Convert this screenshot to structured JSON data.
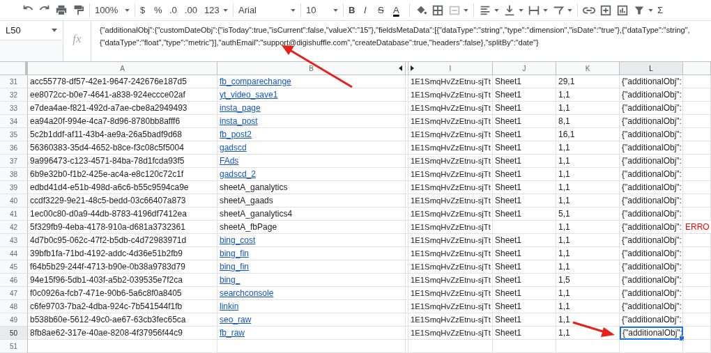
{
  "toolbar": {
    "zoom": "100%",
    "currency": "$",
    "percent": "%",
    "decrease_decimals": ".0",
    "increase_decimals": ".00",
    "number_format": "123",
    "font": "Arial",
    "font_size": "10",
    "bold": "B",
    "italic": "I",
    "strikethrough": "S",
    "text_color": "A",
    "functions": "Σ"
  },
  "name_box": "L50",
  "formula_icon": "fx",
  "formula": [
    "{\"additionalObj\":{\"customDateObj\":{\"isToday\":true,\"isCurrent\":false,\"valueX\":\"15\"},\"fieldsMetaData\":[{\"dataType\":\"string\",\"type\":\"dimension\",\"isDate\":\"true\"},{\"dataType\":\"string\",",
    "{\"dataType\":\"float\",\"type\":\"metric\"}],\"authEmail\":\"support@digishuffle.com\",\"createDatabase\":true,\"headers\":false},\"splitBy\":\"date\"}"
  ],
  "columns": [
    {
      "label": "A",
      "selected": false
    },
    {
      "label": "B",
      "selected": false
    },
    {
      "label": "I",
      "selected": false
    },
    {
      "label": "J",
      "selected": false
    },
    {
      "label": "K",
      "selected": false
    },
    {
      "label": "L",
      "selected": true
    }
  ],
  "rows": [
    {
      "number": "31",
      "a": "acc55778-df57-42e1-9647-242676e187d5",
      "b": "fb_comparechange",
      "link": true,
      "i": "1E1SmqHvZzEtnu-sjTt",
      "j": "Sheet1",
      "k": "29,1",
      "l": "{\"additionalObj\":",
      "selected": false
    },
    {
      "number": "32",
      "a": "ee8072cc-b0e7-4641-a838-924eccce02af",
      "b": "yt_video_save1",
      "link": true,
      "i": "1E1SmqHvZzEtnu-sjTt",
      "j": "Sheet1",
      "k": "1,1",
      "l": "{\"additionalObj\":",
      "selected": false
    },
    {
      "number": "33",
      "a": "e7dea4ae-f821-492d-a7ae-cbe8a2949493",
      "b": "insta_page",
      "link": true,
      "i": "1E1SmqHvZzEtnu-sjTt",
      "j": "Sheet1",
      "k": "1,1",
      "l": "{\"additionalObj\":",
      "selected": false
    },
    {
      "number": "34",
      "a": "ea94a20f-994e-4ca7-8d96-8780bb8afff6",
      "b": "insta_post",
      "link": true,
      "i": "1E1SmqHvZzEtnu-sjTt",
      "j": "Sheet1",
      "k": "8,1",
      "l": "{\"additionalObj\":",
      "selected": false
    },
    {
      "number": "35",
      "a": "5c2b1ddf-af11-43b4-ae9a-26a5badf9d68",
      "b": "fb_post2",
      "link": true,
      "i": "1E1SmqHvZzEtnu-sjTt",
      "j": "Sheet1",
      "k": "16,1",
      "l": "{\"additionalObj\":",
      "selected": false
    },
    {
      "number": "36",
      "a": "56360383-35d4-4652-b8ce-f3c08c5f5004",
      "b": "gadscd",
      "link": true,
      "i": "1E1SmqHvZzEtnu-sjTt",
      "j": "Sheet1",
      "k": "1,1",
      "l": "{\"additionalObj\":",
      "selected": false
    },
    {
      "number": "37",
      "a": "9a996473-c123-4571-84ba-78d1fcda93f5",
      "b": "FAds",
      "link": true,
      "i": "1E1SmqHvZzEtnu-sjTt",
      "j": "Sheet1",
      "k": "1,1",
      "l": "{\"additionalObj\":",
      "selected": false
    },
    {
      "number": "38",
      "a": "6b9e32b0-f1b2-425e-ac4a-e8c120c72c1f",
      "b": "gadscd_2",
      "link": true,
      "i": "1E1SmqHvZzEtnu-sjTt",
      "j": "Sheet1",
      "k": "1,1",
      "l": "{\"additionalObj\":",
      "selected": false
    },
    {
      "number": "39",
      "a": "edbd41d4-e51b-498d-a6c6-b55c9594ca9e",
      "b": "sheetA_ganalytics",
      "link": false,
      "i": "1E1SmqHvZzEtnu-sjTt",
      "j": "Sheet1",
      "k": "1,1",
      "l": "{\"additionalObj\":",
      "selected": false
    },
    {
      "number": "40",
      "a": "ccdf3229-9e21-48c5-bedd-03c66407a873",
      "b": "sheetA_gaads",
      "link": false,
      "i": "1E1SmqHvZzEtnu-sjTt",
      "j": "Sheet1",
      "k": "1,1",
      "l": "{\"additionalObj\":",
      "selected": false
    },
    {
      "number": "41",
      "a": "1ec00c80-d0a9-44db-8783-4196df7412ea",
      "b": "sheetA_ganalytics4",
      "link": false,
      "i": "1E1SmqHvZzEtnu-sjTt",
      "j": "Sheet1",
      "k": "5,1",
      "l": "{\"additionalObj\":",
      "selected": false
    },
    {
      "number": "42",
      "a": "5f329fb9-4eba-4178-910a-d681a3732361",
      "b": "sheetA_fbPage",
      "link": false,
      "i": "1E1SmqHvZzEtnu-sjTt",
      "k": "1,1",
      "l": "{\"additionalObj\":",
      "m": "ERRO",
      "selected": false
    },
    {
      "number": "43",
      "a": "4d7b0c95-062c-47f2-b5db-c4d72983971d",
      "b": "bing_cost",
      "link": true,
      "i": "1E1SmqHvZzEtnu-sjTt",
      "j": "Sheet1",
      "k": "1,1",
      "l": "{\"additionalObj\":",
      "selected": false
    },
    {
      "number": "44",
      "a": "39bfb1fa-71bd-4192-addc-4d36e51b2fb9",
      "b": "bing_fin",
      "link": true,
      "i": "1E1SmqHvZzEtnu-sjTt",
      "j": "Sheet1",
      "k": "1,1",
      "l": "{\"additionalObj\":",
      "selected": false
    },
    {
      "number": "45",
      "a": "f64b5b29-244f-4713-b90e-0b38a9783d79",
      "b": "bing_fin",
      "link": true,
      "i": "1E1SmqHvZzEtnu-sjTt",
      "j": "Sheet1",
      "k": "1,1",
      "l": "{\"additionalObj\":",
      "selected": false
    },
    {
      "number": "46",
      "a": "94e15f96-5db1-403f-a5b2-039535e7f2ca",
      "b": "bing_",
      "link": true,
      "i": "1E1SmqHvZzEtnu-sjTt",
      "j": "Sheet1",
      "k": "1,5",
      "l": "{\"additionalObj\":",
      "selected": false
    },
    {
      "number": "47",
      "a": "f0c0926a-fcb7-471e-90b6-5a6c8f0a8405",
      "b": "searchconsole",
      "link": true,
      "i": "1E1SmqHvZzEtnu-sjTt",
      "j": "Sheet1",
      "k": "1,1",
      "l": "{\"additionalObj\":",
      "selected": false
    },
    {
      "number": "48",
      "a": "c6fe9703-7ba2-4dba-924c-7b541544f1fb",
      "b": "linkin",
      "link": true,
      "i": "1E1SmqHvZzEtnu-sjTt",
      "j": "Sheet1",
      "k": "1,1",
      "l": "{\"additionalObj\":",
      "selected": false
    },
    {
      "number": "49",
      "a": "b538b60e-5612-49c0-ae67-63cb3fec65ca",
      "b": "seo_raw",
      "link": true,
      "i": "1E1SmqHvZzEtnu-sjTt",
      "j": "Sheet1",
      "k": "1,1",
      "l": "{\"additionalObj\":",
      "selected": false
    },
    {
      "number": "50",
      "a": "8fb8ae62-317e-40ae-8208-4f37956f44c9",
      "b": "fb_raw",
      "link": true,
      "i": "1E1SmqHvZzEtnu-sjTt",
      "j": "Sheet1",
      "k": "1,1",
      "l": "{\"additionalObj\":",
      "selected": true
    },
    {
      "number": "51",
      "selected": false
    }
  ]
}
